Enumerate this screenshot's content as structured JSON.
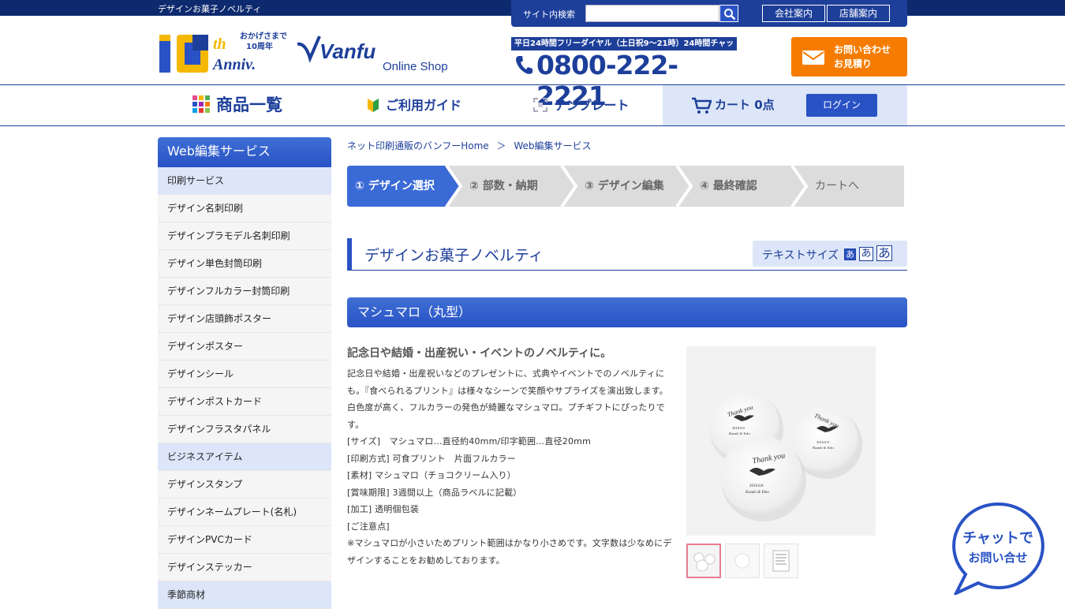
{
  "top": {
    "tagline": "デザインお菓子ノベルティ",
    "search_label": "サイト内検索",
    "search_placeholder": "",
    "company_link": "会社案内",
    "store_link": "店舗案内"
  },
  "brand": {
    "anniv_line1": "おかげさまで",
    "anniv_line2": "10周年",
    "anniv_main": "10th Anniv.",
    "logo": "Vanfu",
    "logo_sub": "Online Shop"
  },
  "phone": {
    "caption": "平日24時間フリーダイヤル（土日祝9〜21時）24時間チャット",
    "number": "0800-222-2221"
  },
  "contact": {
    "line1": "お問い合わせ",
    "line2": "お見積り"
  },
  "nav": {
    "products": "商品一覧",
    "guide": "ご利用ガイド",
    "template": "テンプレート",
    "cart": "カート 0点",
    "login": "ログイン"
  },
  "sidebar": {
    "title": "Web編集サービス",
    "items": [
      {
        "label": "印刷サービス",
        "category": true
      },
      {
        "label": "デザイン名刺印刷",
        "category": false
      },
      {
        "label": "デザインプラモデル名刺印刷",
        "category": false
      },
      {
        "label": "デザイン単色封筒印刷",
        "category": false
      },
      {
        "label": "デザインフルカラー封筒印刷",
        "category": false
      },
      {
        "label": "デザイン店頭飾ポスター",
        "category": false
      },
      {
        "label": "デザインポスター",
        "category": false
      },
      {
        "label": "デザインシール",
        "category": false
      },
      {
        "label": "デザインポストカード",
        "category": false
      },
      {
        "label": "デザインフラスタパネル",
        "category": false
      },
      {
        "label": "ビジネスアイテム",
        "category": true
      },
      {
        "label": "デザインスタンプ",
        "category": false
      },
      {
        "label": "デザインネームプレート(名札)",
        "category": false
      },
      {
        "label": "デザインPVCカード",
        "category": false
      },
      {
        "label": "デザインステッカー",
        "category": false
      },
      {
        "label": "季節商材",
        "category": true
      }
    ]
  },
  "breadcrumb": {
    "home": "ネット印刷通販のバンフーHome",
    "sep": "＞",
    "current": "Web編集サービス"
  },
  "steps": [
    "① デザイン選択",
    "② 部数・納期",
    "③ デザイン編集",
    "④ 最終確認",
    "カートへ"
  ],
  "page": {
    "title": "デザインお菓子ノベルティ",
    "text_size_label": "テキストサイズ",
    "size_small": "あ",
    "size_medium": "あ",
    "size_large": "あ"
  },
  "product": {
    "name": "マシュマロ（丸型）",
    "headline": "記念日や結婚・出産祝い・イベントのノベルティに。",
    "lines": [
      "記念日や結婚・出産祝いなどのプレゼントに、式典やイベントでのノベルティにも。『食べられるプリント』は様々なシーンで笑顔やサプライズを演出致します。白色度が高く、フルカラーの発色が綺麗なマシュマロ。プチギフトにぴったりです。",
      "[サイズ]　マシュマロ…直径約40mm/印字範囲…直径20mm",
      "[印刷方式] 可食プリント　片面フルカラー",
      "[素材] マシュマロ（チョコクリーム入り）",
      "[賞味期限] 3週間以上（商品ラベルに記載）",
      "[加工] 透明個包装",
      "[ご注意点]",
      "※マシュマロが小さいためプリント範囲はかなり小さめです。文字数は少なめにデザインすることをお勧めしております。"
    ],
    "print_text_1": "Thank you",
    "print_text_2": "2016.8.8",
    "print_text_3": "Kazuki & Yoko"
  },
  "chat": {
    "line1": "チャットで",
    "line2": "お問い合せ"
  },
  "colors": {
    "navy": "#0d2a6e",
    "blue": "#2952c5",
    "light_blue": "#dce6f8",
    "orange": "#f57c00",
    "active_step": "#3a6ad6"
  }
}
